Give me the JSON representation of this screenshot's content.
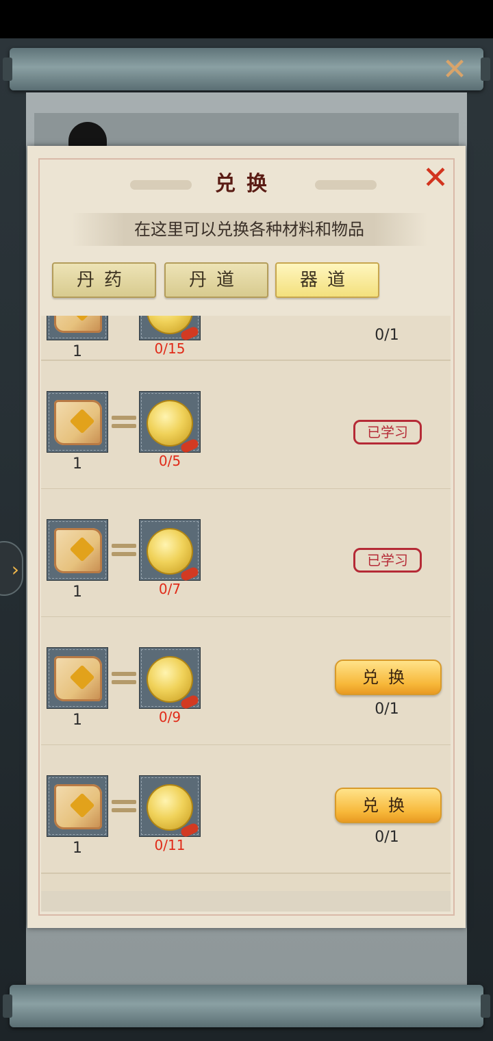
{
  "outer_window": {
    "close_symbol": "✕",
    "side_tab_symbol": "›"
  },
  "dialog": {
    "title": "兑换",
    "close_symbol": "✕",
    "subtitle": "在这里可以兑换各种材料和物品",
    "tabs": [
      {
        "label": "丹药",
        "active": false
      },
      {
        "label": "丹道",
        "active": false
      },
      {
        "label": "器道",
        "active": true
      }
    ],
    "rows": [
      {
        "cost_qty": "1",
        "required": "0/15",
        "status": "count",
        "count": "0/1"
      },
      {
        "cost_qty": "1",
        "required": "0/5",
        "status": "learned",
        "learned_label": "已学习"
      },
      {
        "cost_qty": "1",
        "required": "0/7",
        "status": "learned",
        "learned_label": "已学习"
      },
      {
        "cost_qty": "1",
        "required": "0/9",
        "status": "exchange",
        "button_label": "兑换",
        "count": "0/1"
      },
      {
        "cost_qty": "1",
        "required": "0/11",
        "status": "exchange",
        "button_label": "兑换",
        "count": "0/1"
      }
    ]
  },
  "colors": {
    "required_text": "#e02a18",
    "learned_stamp": "#b52a36",
    "exchange_button": "#f7b83a",
    "title_text": "#5a1c14",
    "close_x": "#d2341e"
  }
}
